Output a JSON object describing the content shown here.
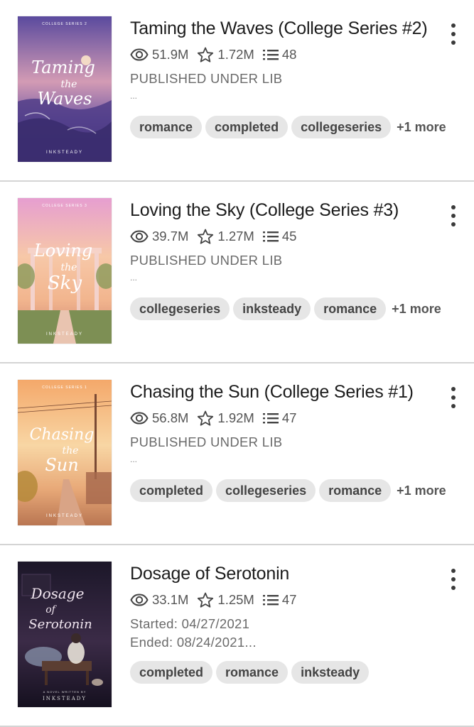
{
  "stories": [
    {
      "title": "Taming the Waves (College Series #2)",
      "reads": "51.9M",
      "votes": "1.72M",
      "parts": "48",
      "description": "PUBLISHED UNDER LIB",
      "ellipsis": "...",
      "tags": [
        "romance",
        "completed",
        "collegeseries"
      ],
      "more": "+1 more",
      "cover": {
        "series": "COLLEGE SERIES 2",
        "script1": "Taming",
        "script2": "the",
        "script3": "Waves",
        "author": "INKSTEADY",
        "top": "#6a5aa8",
        "mid": "#c98aa8",
        "bottom": "#3c2f6e"
      }
    },
    {
      "title": "Loving the Sky (College Series #3)",
      "reads": "39.7M",
      "votes": "1.27M",
      "parts": "45",
      "description": "PUBLISHED UNDER LIB",
      "ellipsis": "...",
      "tags": [
        "collegeseries",
        "inksteady",
        "romance"
      ],
      "more": "+1 more",
      "cover": {
        "series": "COLLEGE SERIES 3",
        "script1": "Loving",
        "script2": "the",
        "script3": "Sky",
        "author": "INKSTEADY",
        "top": "#e8a6cc",
        "mid": "#f3c49a",
        "bottom": "#d98a7a"
      }
    },
    {
      "title": "Chasing the Sun (College Series #1)",
      "reads": "56.8M",
      "votes": "1.92M",
      "parts": "47",
      "description": "PUBLISHED UNDER LIB",
      "ellipsis": "...",
      "tags": [
        "completed",
        "collegeseries",
        "romance"
      ],
      "more": "+1 more",
      "cover": {
        "series": "COLLEGE SERIES 1",
        "script1": "Chasing",
        "script2": "the",
        "script3": "Sun",
        "author": "INKSTEADY",
        "top": "#f6b57a",
        "mid": "#f2cf9a",
        "bottom": "#c9875a"
      }
    },
    {
      "title": "Dosage of Serotonin",
      "reads": "33.1M",
      "votes": "1.25M",
      "parts": "47",
      "started": "Started: 04/27/2021",
      "ended": "Ended: 08/24/2021...",
      "tags": [
        "completed",
        "romance",
        "inksteady"
      ],
      "more": "",
      "cover": {
        "series": "",
        "script1": "Dosage",
        "script2": "of",
        "script3": "Serotonin",
        "tagline": "A NOVEL WRITTEN BY",
        "author": "INKSTEADY",
        "top": "#1f1a30",
        "mid": "#3a2a45",
        "bottom": "#1a1428"
      }
    }
  ],
  "icons": {
    "reads": "eye-icon",
    "votes": "star-icon",
    "parts": "list-icon",
    "menu": "more-vertical-icon"
  }
}
